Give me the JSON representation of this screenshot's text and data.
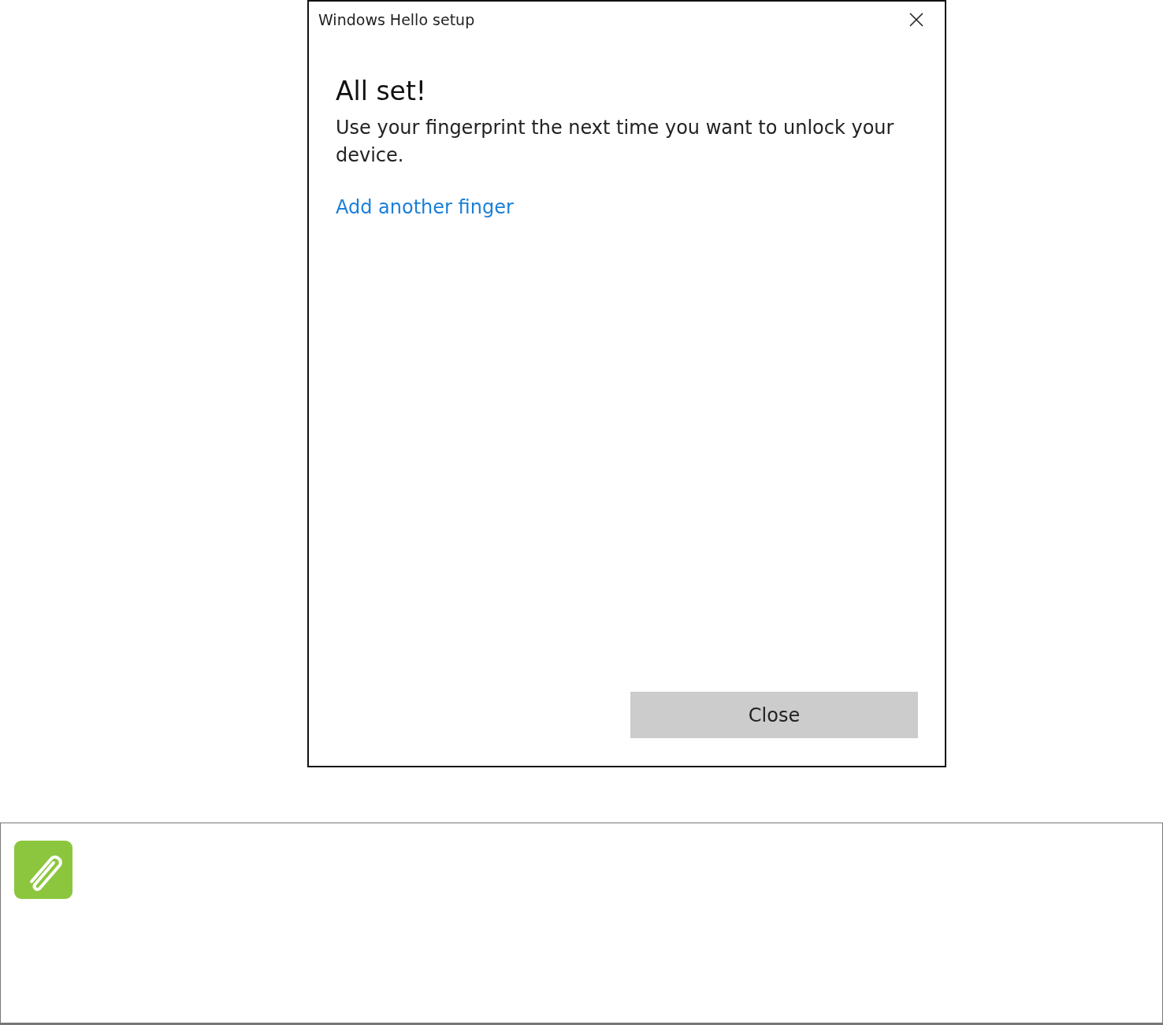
{
  "dialog": {
    "title": "Windows Hello setup",
    "heading": "All set!",
    "message": "Use your fingerprint the next time you want to unlock your device.",
    "link": "Add another finger",
    "button": "Close"
  }
}
